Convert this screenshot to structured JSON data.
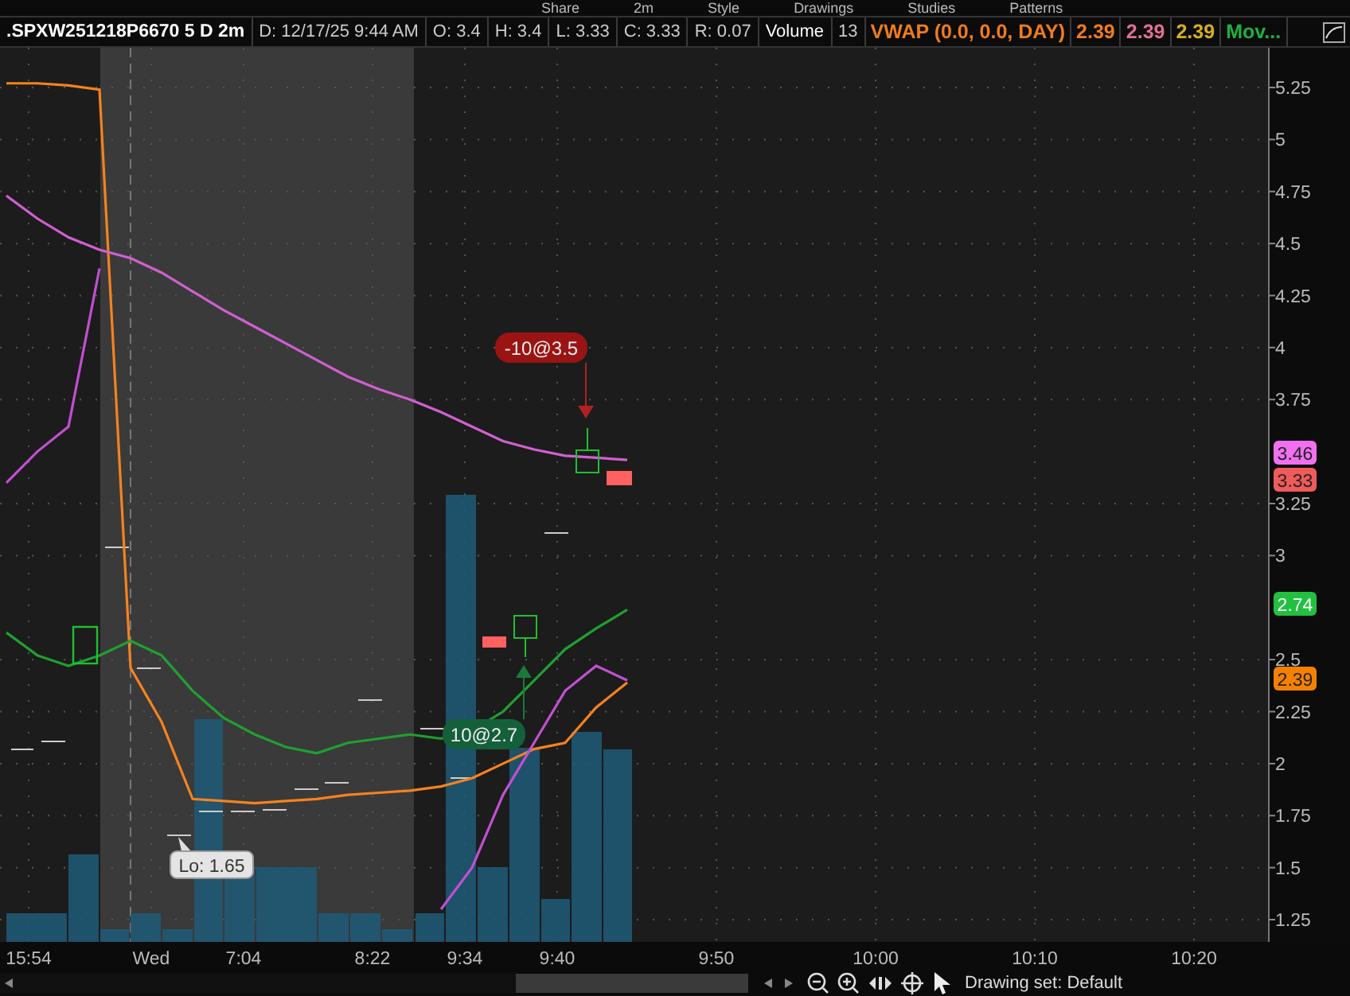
{
  "toolbar": [
    {
      "label": "Share"
    },
    {
      "label": "2m"
    },
    {
      "label": "Style"
    },
    {
      "label": "Drawings"
    },
    {
      "label": "Studies"
    },
    {
      "label": "Patterns"
    }
  ],
  "header": {
    "symbol": ".SPXW251218P6670 5 D 2m",
    "fields": [
      "D: 12/17/25 9:44 AM",
      "O: 3.4",
      "H: 3.4",
      "L: 3.33",
      "C: 3.33",
      "R: 0.07"
    ],
    "volume_label": "Volume",
    "volume_value": "13",
    "studies": [
      "VWAP (0.0, 0.0, DAY)",
      "2.39",
      "2.39",
      "2.39",
      "Mov..."
    ]
  },
  "chart": {
    "price_axis_labels": [
      "5.25",
      "5",
      "4.75",
      "4.5",
      "4.25",
      "4",
      "3.75",
      "3.25",
      "3",
      "2.5",
      "2.25",
      "2",
      "1.75",
      "1.5",
      "1.25"
    ],
    "time_labels": [
      "15:54",
      "Wed",
      "7:04",
      "8:22",
      "9:34",
      "9:40",
      "9:50",
      "10:00",
      "10:10",
      "10:20"
    ],
    "markers": [
      {
        "text": "-10@3.5",
        "kind": "sell"
      },
      {
        "text": "10@2.7",
        "kind": "buy"
      },
      {
        "text": "Lo: 1.65",
        "kind": "low"
      }
    ],
    "price_labels": [
      {
        "text": "3.46",
        "color": "#f070f0"
      },
      {
        "text": "3.33",
        "color": "#f05a5a"
      },
      {
        "text": "2.74",
        "color": "#22c040"
      },
      {
        "text": "2.39",
        "color": "#f58000"
      }
    ]
  },
  "footer": {
    "drawing_set": "Drawing set: Default"
  }
}
